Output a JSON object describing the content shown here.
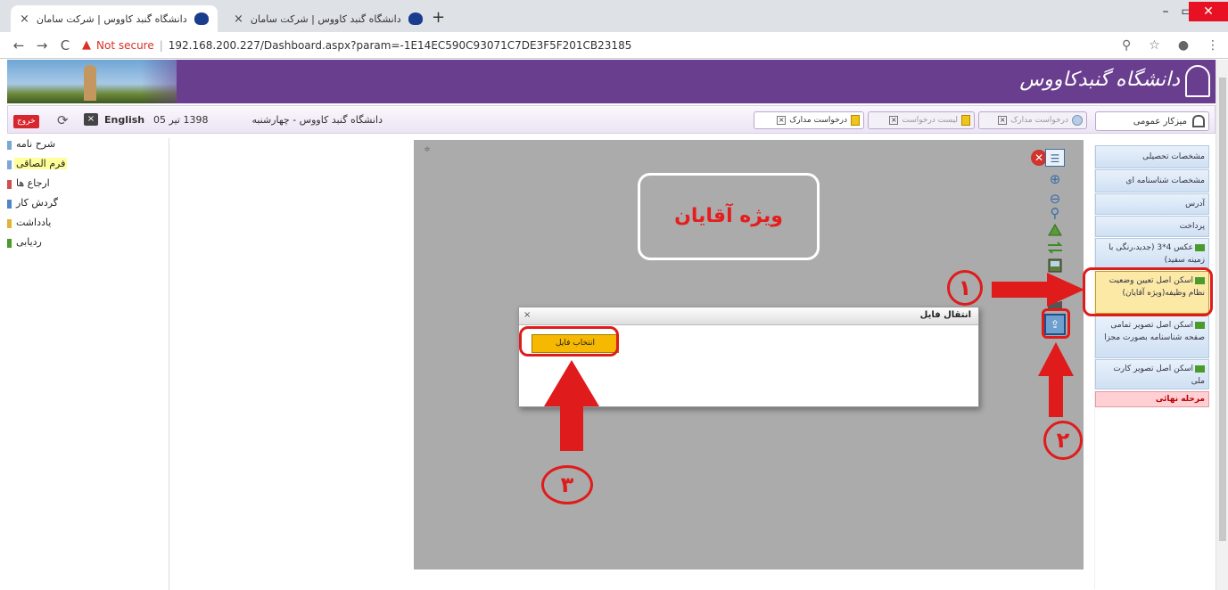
{
  "browser": {
    "tabs": [
      {
        "title": "دانشگاه گنبد کاووس | شرکت سامان",
        "active": true
      },
      {
        "title": "دانشگاه گنبد کاووس | شرکت سامان",
        "active": false
      }
    ],
    "new_tab": "+",
    "close_glyph": "×",
    "window_controls": {
      "minimize": "–",
      "maximize": "▭",
      "close": "✕"
    },
    "nav": {
      "back": "←",
      "forward": "→",
      "reload": "C"
    },
    "not_secure": "Not secure",
    "url": "192.168.200.227/Dashboard.aspx?param=-1E14EC590C93071C7DE3F5F201CB23185",
    "right_icons": {
      "zoom": "⚲",
      "star": "☆",
      "profile": "●",
      "menu": "⋮"
    }
  },
  "site": {
    "logo_text": "دانشگاه گنبدکاووس",
    "colors": {
      "banner": "#6a3e8f",
      "accent": "#e01b1b",
      "button": "#f6b800"
    }
  },
  "userbar": {
    "logout": "خروج",
    "lang_icon": "×",
    "refresh_icon": "⟳",
    "language": "English",
    "date_short": "1398 تیر 05",
    "university_date": "دانشگاه گنبد کاووس - چهارشنبه",
    "home_tab": "میزکار عمومی",
    "open_tabs": [
      {
        "label": "درخواست مدارک",
        "active": true
      },
      {
        "label": "لیست درخواست",
        "active": false
      },
      {
        "label": "درخواست مدارک",
        "active": false
      }
    ]
  },
  "doc_tree": {
    "items": [
      {
        "label": "شرح نامه",
        "active": false
      },
      {
        "label": "فرم الصاقی",
        "active": true
      },
      {
        "label": "ارجاع ها",
        "active": false
      },
      {
        "label": "گردش کار",
        "active": false
      },
      {
        "label": "یادداشت",
        "active": false
      },
      {
        "label": "ردیابی",
        "active": false
      }
    ]
  },
  "viewer": {
    "corner_label": "≑",
    "men_only_label": "ویژه آقایان",
    "tools": {
      "close": "✕",
      "list": "☰",
      "zoom_in": "⊕",
      "zoom_out": "⊖",
      "search": "⚲",
      "upload": "⇪"
    }
  },
  "file_dialog": {
    "title": "انتقال فایل",
    "close": "×",
    "select_file": "انتخاب فایل"
  },
  "right_nav": {
    "items": [
      {
        "label": "مشخصات تحصیلی",
        "icon": false,
        "active": false
      },
      {
        "label": "مشخصات شناسنامه ای",
        "icon": false,
        "active": false
      },
      {
        "label": "آدرس",
        "icon": false,
        "active": false
      },
      {
        "label": "پرداخت",
        "icon": false,
        "active": false
      },
      {
        "label": "عکس 4*3 (جدید،رنگی با زمینه سفید)",
        "icon": true,
        "active": false
      },
      {
        "label": "اسکن اصل تعیین وضعیت نظام وظیفه(ویژه آقایان)",
        "icon": true,
        "active": true
      },
      {
        "label": "اسکن اصل تصویر تمامی صفحه شناسنامه بصورت مجزا",
        "icon": true,
        "active": false
      },
      {
        "label": "اسکن اصل تصویر کارت ملی",
        "icon": true,
        "active": false
      }
    ],
    "final_step": "مرحله نهائی"
  },
  "annotations": {
    "step1": "۱",
    "step2": "۲",
    "step3": "۳"
  }
}
